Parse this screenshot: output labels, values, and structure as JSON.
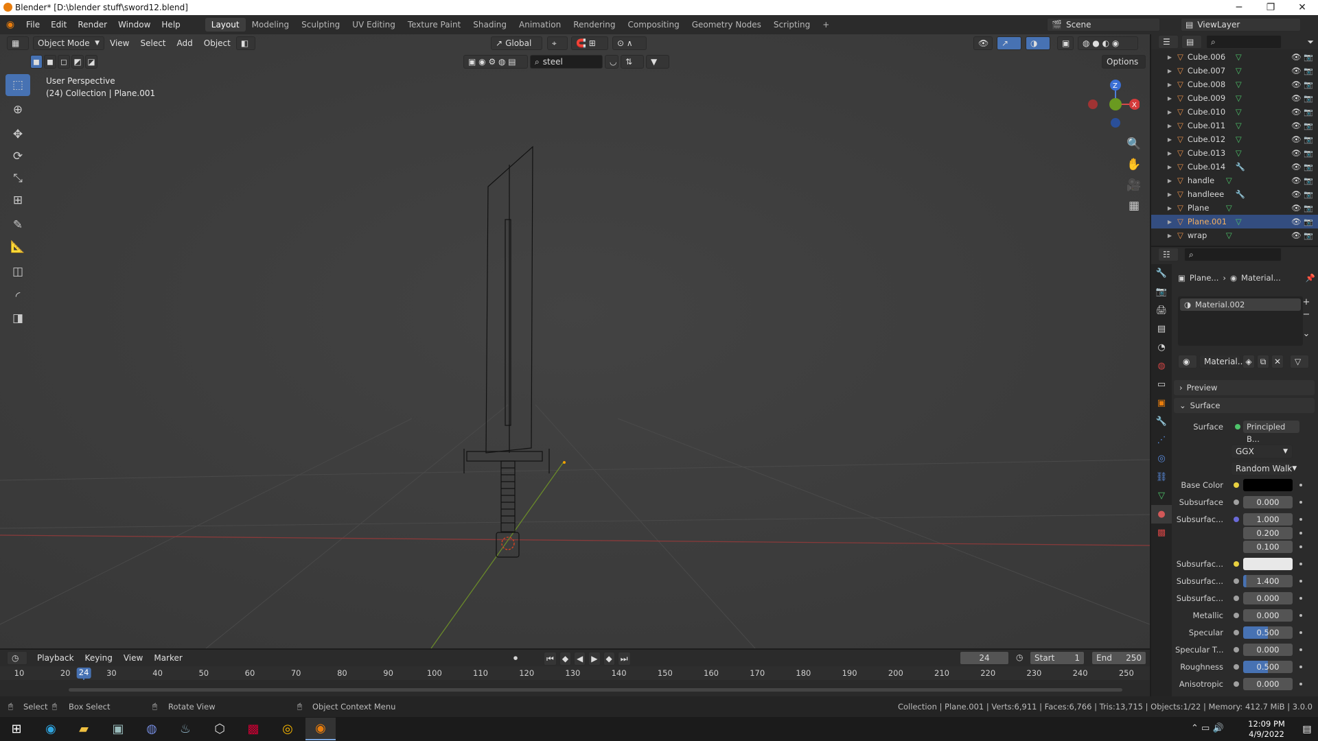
{
  "window": {
    "title": "Blender* [D:\\blender stuff\\sword12.blend]"
  },
  "menu": {
    "items": [
      "File",
      "Edit",
      "Render",
      "Window",
      "Help"
    ]
  },
  "workspaces": [
    "Layout",
    "Modeling",
    "Sculpting",
    "UV Editing",
    "Texture Paint",
    "Shading",
    "Animation",
    "Rendering",
    "Compositing",
    "Geometry Nodes",
    "Scripting",
    "+"
  ],
  "scene": {
    "label": "Scene",
    "view_layer": "ViewLayer"
  },
  "viewport_header": {
    "mode": "Object Mode",
    "menus": [
      "View",
      "Select",
      "Add",
      "Object"
    ],
    "orientation": "Global",
    "search_value": "steel",
    "options": "Options"
  },
  "viewport_info": {
    "line1": "User Perspective",
    "line2": "(24) Collection | Plane.001"
  },
  "gizmo": {
    "z": "Z",
    "x": "X"
  },
  "outliner": {
    "items": [
      {
        "name": "Cube.006",
        "type": "mesh"
      },
      {
        "name": "Cube.007",
        "type": "mesh"
      },
      {
        "name": "Cube.008",
        "type": "mesh"
      },
      {
        "name": "Cube.009",
        "type": "mesh"
      },
      {
        "name": "Cube.010",
        "type": "mesh"
      },
      {
        "name": "Cube.011",
        "type": "mesh"
      },
      {
        "name": "Cube.012",
        "type": "mesh"
      },
      {
        "name": "Cube.013",
        "type": "mesh"
      },
      {
        "name": "Cube.014",
        "type": "modifier"
      },
      {
        "name": "handle",
        "type": "mesh"
      },
      {
        "name": "handleee",
        "type": "modifier"
      },
      {
        "name": "Plane",
        "type": "mesh"
      },
      {
        "name": "Plane.001",
        "type": "mesh",
        "selected": true
      },
      {
        "name": "wrap",
        "type": "mesh"
      }
    ]
  },
  "properties": {
    "breadcrumb": {
      "object": "Plane...",
      "material": "Material..."
    },
    "slot": "Material.002",
    "material_name": "Material...",
    "preview": "Preview",
    "surface_panel": "Surface",
    "surface": {
      "label": "Surface",
      "value": "Principled B..."
    },
    "distribution": "GGX",
    "subsurface_method": "Random Walk",
    "rows": [
      {
        "label": "Base Color",
        "value": "",
        "kind": "color",
        "color": "#000000"
      },
      {
        "label": "Subsurface",
        "value": "0.000"
      },
      {
        "label": "Subsurfac...",
        "value": "1.000"
      },
      {
        "label": "",
        "value": "0.200"
      },
      {
        "label": "",
        "value": "0.100"
      },
      {
        "label": "Subsurfac...",
        "value": "",
        "kind": "color",
        "color": "#e8e8e8"
      },
      {
        "label": "Subsurfac...",
        "value": "1.400",
        "fill": 0.06
      },
      {
        "label": "Subsurfac...",
        "value": "0.000"
      },
      {
        "label": "Metallic",
        "value": "0.000"
      },
      {
        "label": "Specular",
        "value": "0.500",
        "fill": 0.5
      },
      {
        "label": "Specular T...",
        "value": "0.000"
      },
      {
        "label": "Roughness",
        "value": "0.500",
        "fill": 0.5
      },
      {
        "label": "Anisotropic",
        "value": "0.000"
      }
    ]
  },
  "timeline": {
    "menus": [
      "Playback",
      "Keying",
      "View",
      "Marker"
    ],
    "current_frame": "24",
    "start_label": "Start",
    "start": "1",
    "end_label": "End",
    "end": "250",
    "ticks": [
      "10",
      "20",
      "30",
      "40",
      "50",
      "60",
      "70",
      "80",
      "90",
      "100",
      "110",
      "120",
      "130",
      "140",
      "150",
      "160",
      "170",
      "180",
      "190",
      "200",
      "210",
      "220",
      "230",
      "240",
      "250"
    ]
  },
  "statusbar": {
    "select": "Select",
    "box_select": "Box Select",
    "rotate": "Rotate View",
    "context": "Object Context Menu",
    "stats": "Collection | Plane.001 | Verts:6,911 | Faces:6,766 | Tris:13,715 | Objects:1/22 | Memory: 412.7 MiB | 3.0.0"
  },
  "taskbar": {
    "time": "12:09 PM",
    "date": "4/9/2022"
  }
}
